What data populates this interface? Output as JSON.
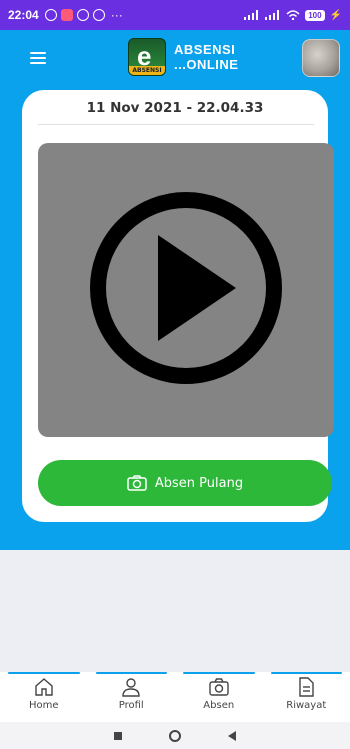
{
  "status_bar": {
    "time": "22:04",
    "dots": "···",
    "battery": "100"
  },
  "app_bar": {
    "logo_top": "ABSENSI",
    "logo_bottom": "...ONLINE",
    "badge_letter": "e",
    "badge_strip": "ABSENSI"
  },
  "card": {
    "datetime": "11 Nov 2021 - 22.04.33",
    "button_label": "Absen Pulang"
  },
  "bottom_nav": {
    "items": [
      {
        "label": "Home",
        "icon": "home-icon"
      },
      {
        "label": "Profil",
        "icon": "person-icon"
      },
      {
        "label": "Absen",
        "icon": "camera-icon"
      },
      {
        "label": "Riwayat",
        "icon": "document-icon"
      }
    ]
  },
  "colors": {
    "status": "#6a2fe0",
    "primary": "#0aa2ec",
    "button": "#2db83a",
    "video_bg": "#848484"
  }
}
